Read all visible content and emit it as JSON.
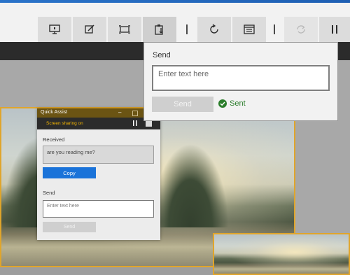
{
  "toolbar": {
    "buttons": [
      {
        "icon": "monitor-icon"
      },
      {
        "icon": "annotate-icon"
      },
      {
        "icon": "fit-screen-icon"
      },
      {
        "icon": "clipboard-icon"
      },
      {
        "icon": "restart-icon"
      },
      {
        "icon": "task-manager-icon"
      },
      {
        "icon": "reconnect-icon"
      },
      {
        "icon": "pause-icon"
      }
    ]
  },
  "send_panel": {
    "title": "Send",
    "input_placeholder": "Enter text here",
    "send_label": "Send",
    "status_text": "Sent",
    "status_color": "#2b7d2b"
  },
  "quick_assist": {
    "title": "Quick Assist",
    "status_text": "Screen sharing on",
    "received_label": "Received",
    "received_text": "are you reading me?",
    "copy_label": "Copy",
    "send_label_heading": "Send",
    "send_placeholder": "Enter text here",
    "send_button_label": "Send"
  },
  "colors": {
    "accent": "#1a73d9",
    "titlebar": "#6b5413",
    "status_text": "#f4b400",
    "image_border": "#e0a52b"
  }
}
